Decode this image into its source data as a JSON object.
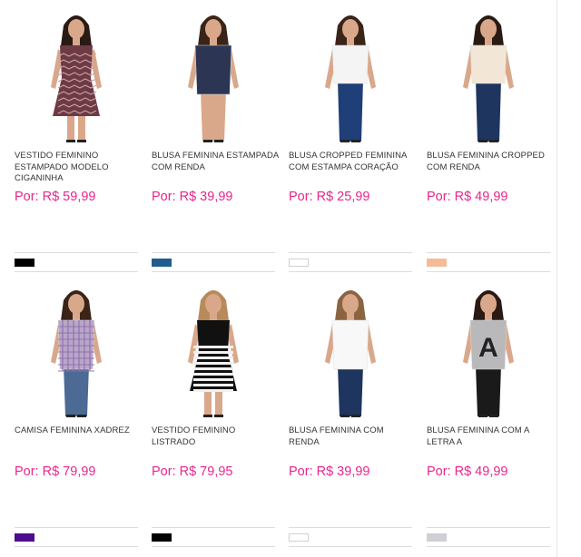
{
  "products": [
    {
      "name": "VESTIDO FEMININO ESTAMPADO MODELO CIGANINHA",
      "price": "Por: R$ 59,99",
      "swatch": "#000000",
      "outfit": "dress-pattern",
      "top": "#6e3a44",
      "bottom": "#6e3a44",
      "skin": "#d9a88a",
      "hair": "#2a1a14"
    },
    {
      "name": "BLUSA FEMININA ESTAMPADA COM RENDA",
      "price": "Por: R$ 39,99",
      "swatch": "#1f5e8e",
      "outfit": "blouse",
      "top": "#2d3554",
      "bottom": "#d9a88a",
      "skin": "#d9a88a",
      "hair": "#3a2418"
    },
    {
      "name": "BLUSA CROPPED FEMININA COM ESTAMPA CORAÇÃO",
      "price": "Por: R$ 25,99",
      "swatch": "#ffffff",
      "outfit": "cropped",
      "top": "#f4f4f4",
      "bottom": "#1e3f78",
      "skin": "#d9a88a",
      "hair": "#3a2418"
    },
    {
      "name": "BLUSA FEMININA CROPPED COM RENDA",
      "price": "Por: R$ 49,99",
      "swatch": "#f4bb97",
      "outfit": "cropped",
      "top": "#f2e7d6",
      "bottom": "#1e3560",
      "skin": "#d9a88a",
      "hair": "#2a1a14"
    },
    {
      "name": "CAMISA FEMININA XADREZ",
      "price": "Por: R$ 79,99",
      "swatch": "#4d0d8e",
      "outfit": "shirt",
      "top": "#b9a6c8",
      "bottom": "#4c6a94",
      "skin": "#d9a88a",
      "hair": "#3a2418"
    },
    {
      "name": "VESTIDO FEMININO LISTRADO",
      "price": "Por: R$ 79,95",
      "swatch": "#000000",
      "outfit": "dress-stripes",
      "top": "#111111",
      "bottom": "#111111",
      "skin": "#d9a88a",
      "hair": "#b88a5a"
    },
    {
      "name": "BLUSA FEMININA COM RENDA",
      "price": "Por: R$ 39,99",
      "swatch": "#ffffff",
      "outfit": "blouse",
      "top": "#f8f8f8",
      "bottom": "#1e3560",
      "skin": "#d9a88a",
      "hair": "#8a6440"
    },
    {
      "name": "BLUSA FEMININA COM A LETRA A",
      "price": "Por: R$ 49,99",
      "swatch": "#cfcfd4",
      "outfit": "sweater",
      "top": "#b9b9bb",
      "bottom": "#1a1a1a",
      "skin": "#d9a88a",
      "hair": "#2a1a14"
    }
  ]
}
